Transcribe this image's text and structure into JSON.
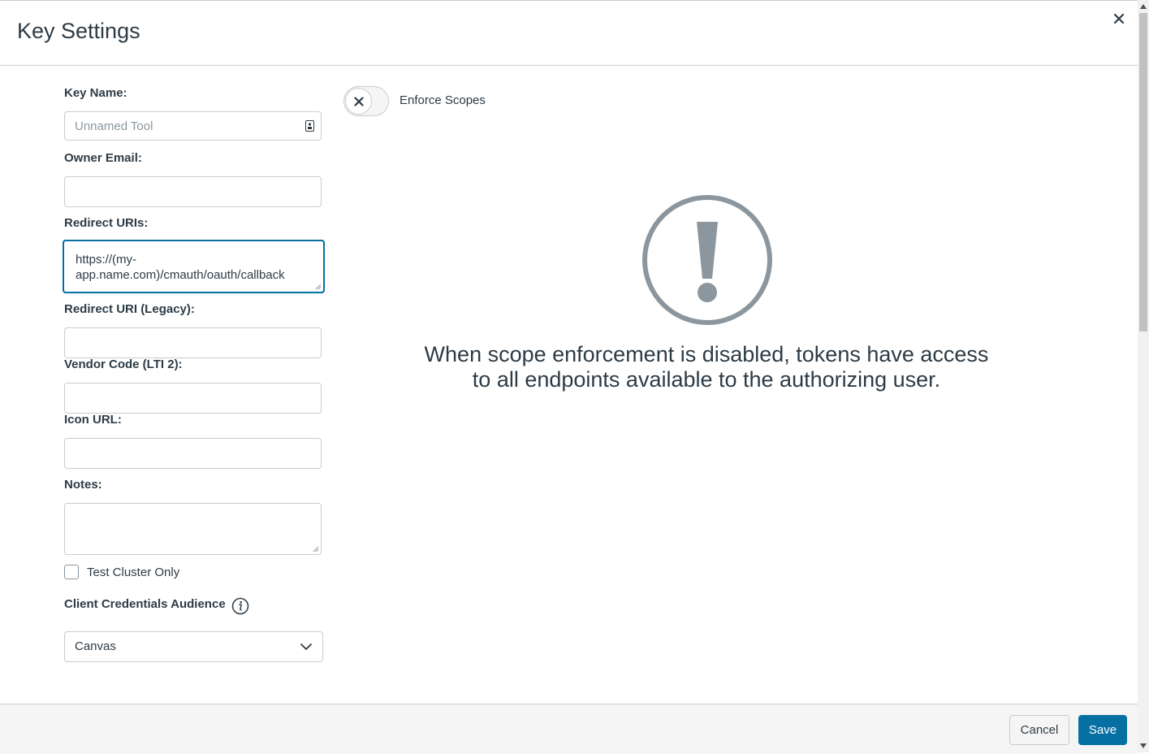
{
  "modal": {
    "title": "Key Settings",
    "close_icon": "close-icon"
  },
  "form": {
    "key_name": {
      "label": "Key Name:",
      "placeholder": "Unnamed Tool",
      "value": ""
    },
    "owner_email": {
      "label": "Owner Email:",
      "value": ""
    },
    "redirect_uris": {
      "label": "Redirect URIs:",
      "value_line1": "https://(my-",
      "value_line2": "app.name.com)/cmauth/oauth/callback"
    },
    "redirect_uri_legacy": {
      "label": "Redirect URI (Legacy):",
      "value": ""
    },
    "vendor_code": {
      "label": "Vendor Code (LTI 2):",
      "value": ""
    },
    "icon_url": {
      "label": "Icon URL:",
      "value": ""
    },
    "notes": {
      "label": "Notes:",
      "value": ""
    },
    "test_cluster_only": {
      "label": "Test Cluster Only",
      "checked": false
    },
    "client_credentials_audience": {
      "label": "Client Credentials Audience",
      "selected": "Canvas"
    }
  },
  "scopes": {
    "toggle_label": "Enforce Scopes",
    "enabled": false,
    "warning_line1": "When scope enforcement is disabled, tokens have access",
    "warning_line2": "to all endpoints available to the authorizing user."
  },
  "footer": {
    "cancel_label": "Cancel",
    "save_label": "Save"
  },
  "colors": {
    "primary": "#0770a3",
    "text": "#2d3b45",
    "border": "#c7cdd1",
    "icon_gray": "#8b969e"
  }
}
